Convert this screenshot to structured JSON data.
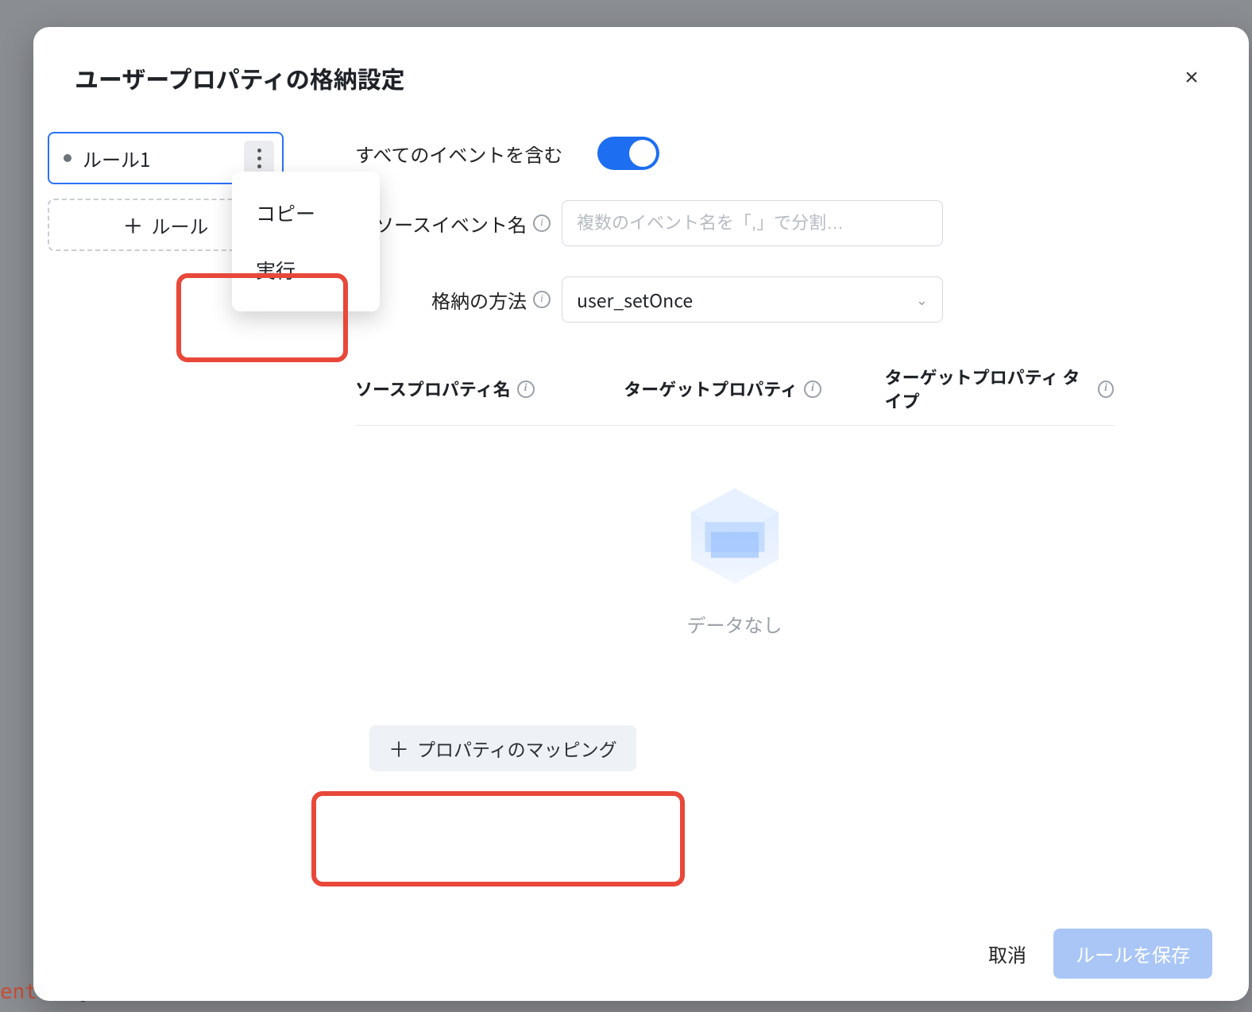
{
  "modal": {
    "title": "ユーザープロパティの格納設定",
    "close": "×"
  },
  "sidebar": {
    "rule_name": "ルール1",
    "add_rule": "ルール",
    "menu": {
      "copy": "コピー",
      "run": "実行"
    }
  },
  "main": {
    "include_all_label": "すべてのイベントを含む",
    "include_all_on": true,
    "source_event_label": "ソースイベント名",
    "source_event_placeholder": "複数のイベント名を「,」で分割…",
    "store_method_label": "格納の方法",
    "store_method_value": "user_setOnce",
    "table": {
      "col1": "ソースプロパティ名",
      "col2": "ターゲットプロパティ",
      "col3": "ターゲットプロパティ タイプ"
    },
    "empty_text": "データなし",
    "add_mapping": "プロパティのマッピング"
  },
  "footer": {
    "cancel": "取消",
    "save": "ルールを保存"
  },
  "bg_code": "ent\"",
  "bg_code_suffix": ": {"
}
